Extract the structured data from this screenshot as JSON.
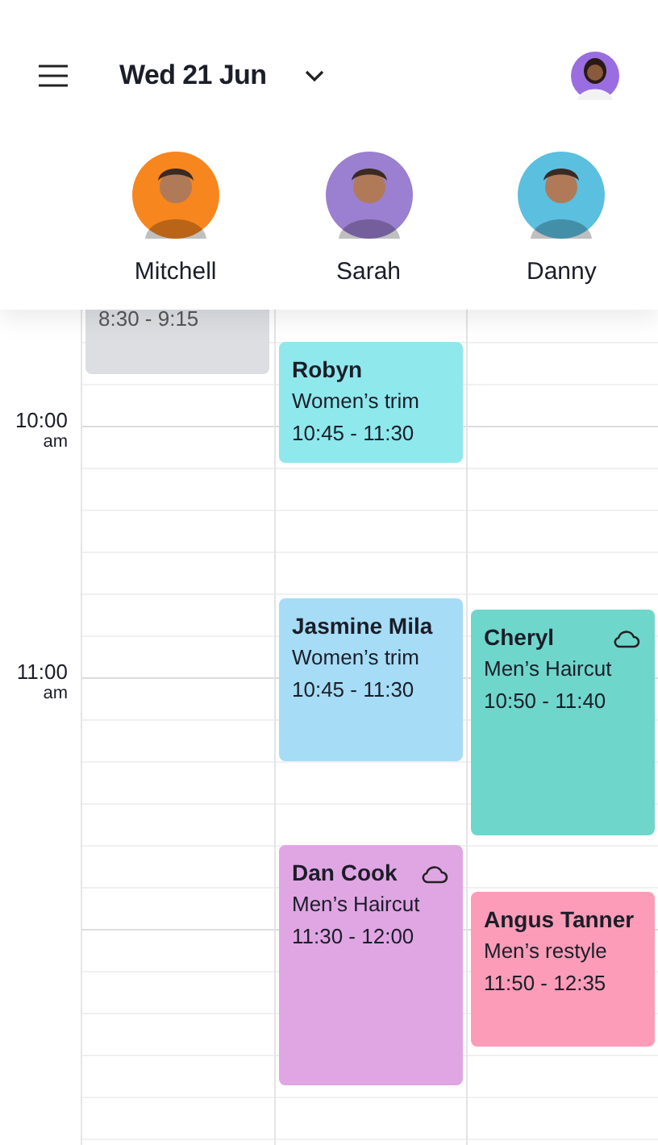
{
  "header": {
    "date": "Wed 21 Jun"
  },
  "staff": [
    {
      "name": "Mitchell",
      "color": "#f7861e",
      "appointments": [
        {
          "time": "8:30 - 9:15",
          "color": "#dcdee1",
          "cloud_icon": false
        }
      ]
    },
    {
      "name": "Sarah",
      "color": "#9b7fd0",
      "appointments": [
        {
          "client": "Robyn",
          "service": "Women’s trim",
          "time": "10:45 - 11:30",
          "color": "#8ee8ec",
          "cloud_icon": false
        },
        {
          "client": "Jasmine Mila",
          "service": "Women’s trim",
          "time": "10:45 - 11:30",
          "color": "#a6dcf5",
          "cloud_icon": false
        },
        {
          "client": "Dan Cook",
          "service": "Men’s Haircut",
          "time": "11:30 - 12:00",
          "color": "#e0a6e3",
          "cloud_icon": true
        }
      ]
    },
    {
      "name": "Danny",
      "color": "#5bbfe0",
      "appointments": [
        {
          "client": "Cheryl",
          "service": "Men’s Haircut",
          "time": "10:50 - 11:40",
          "color": "#6fd6cc",
          "cloud_icon": true
        },
        {
          "client": "Angus Tanner",
          "service": "Men’s restyle",
          "time": "11:50 - 12:35",
          "color": "#fc9cb8",
          "cloud_icon": false
        }
      ]
    }
  ],
  "time_labels": [
    {
      "hour": "10:00",
      "period": "am"
    },
    {
      "hour": "11:00",
      "period": "am"
    }
  ]
}
